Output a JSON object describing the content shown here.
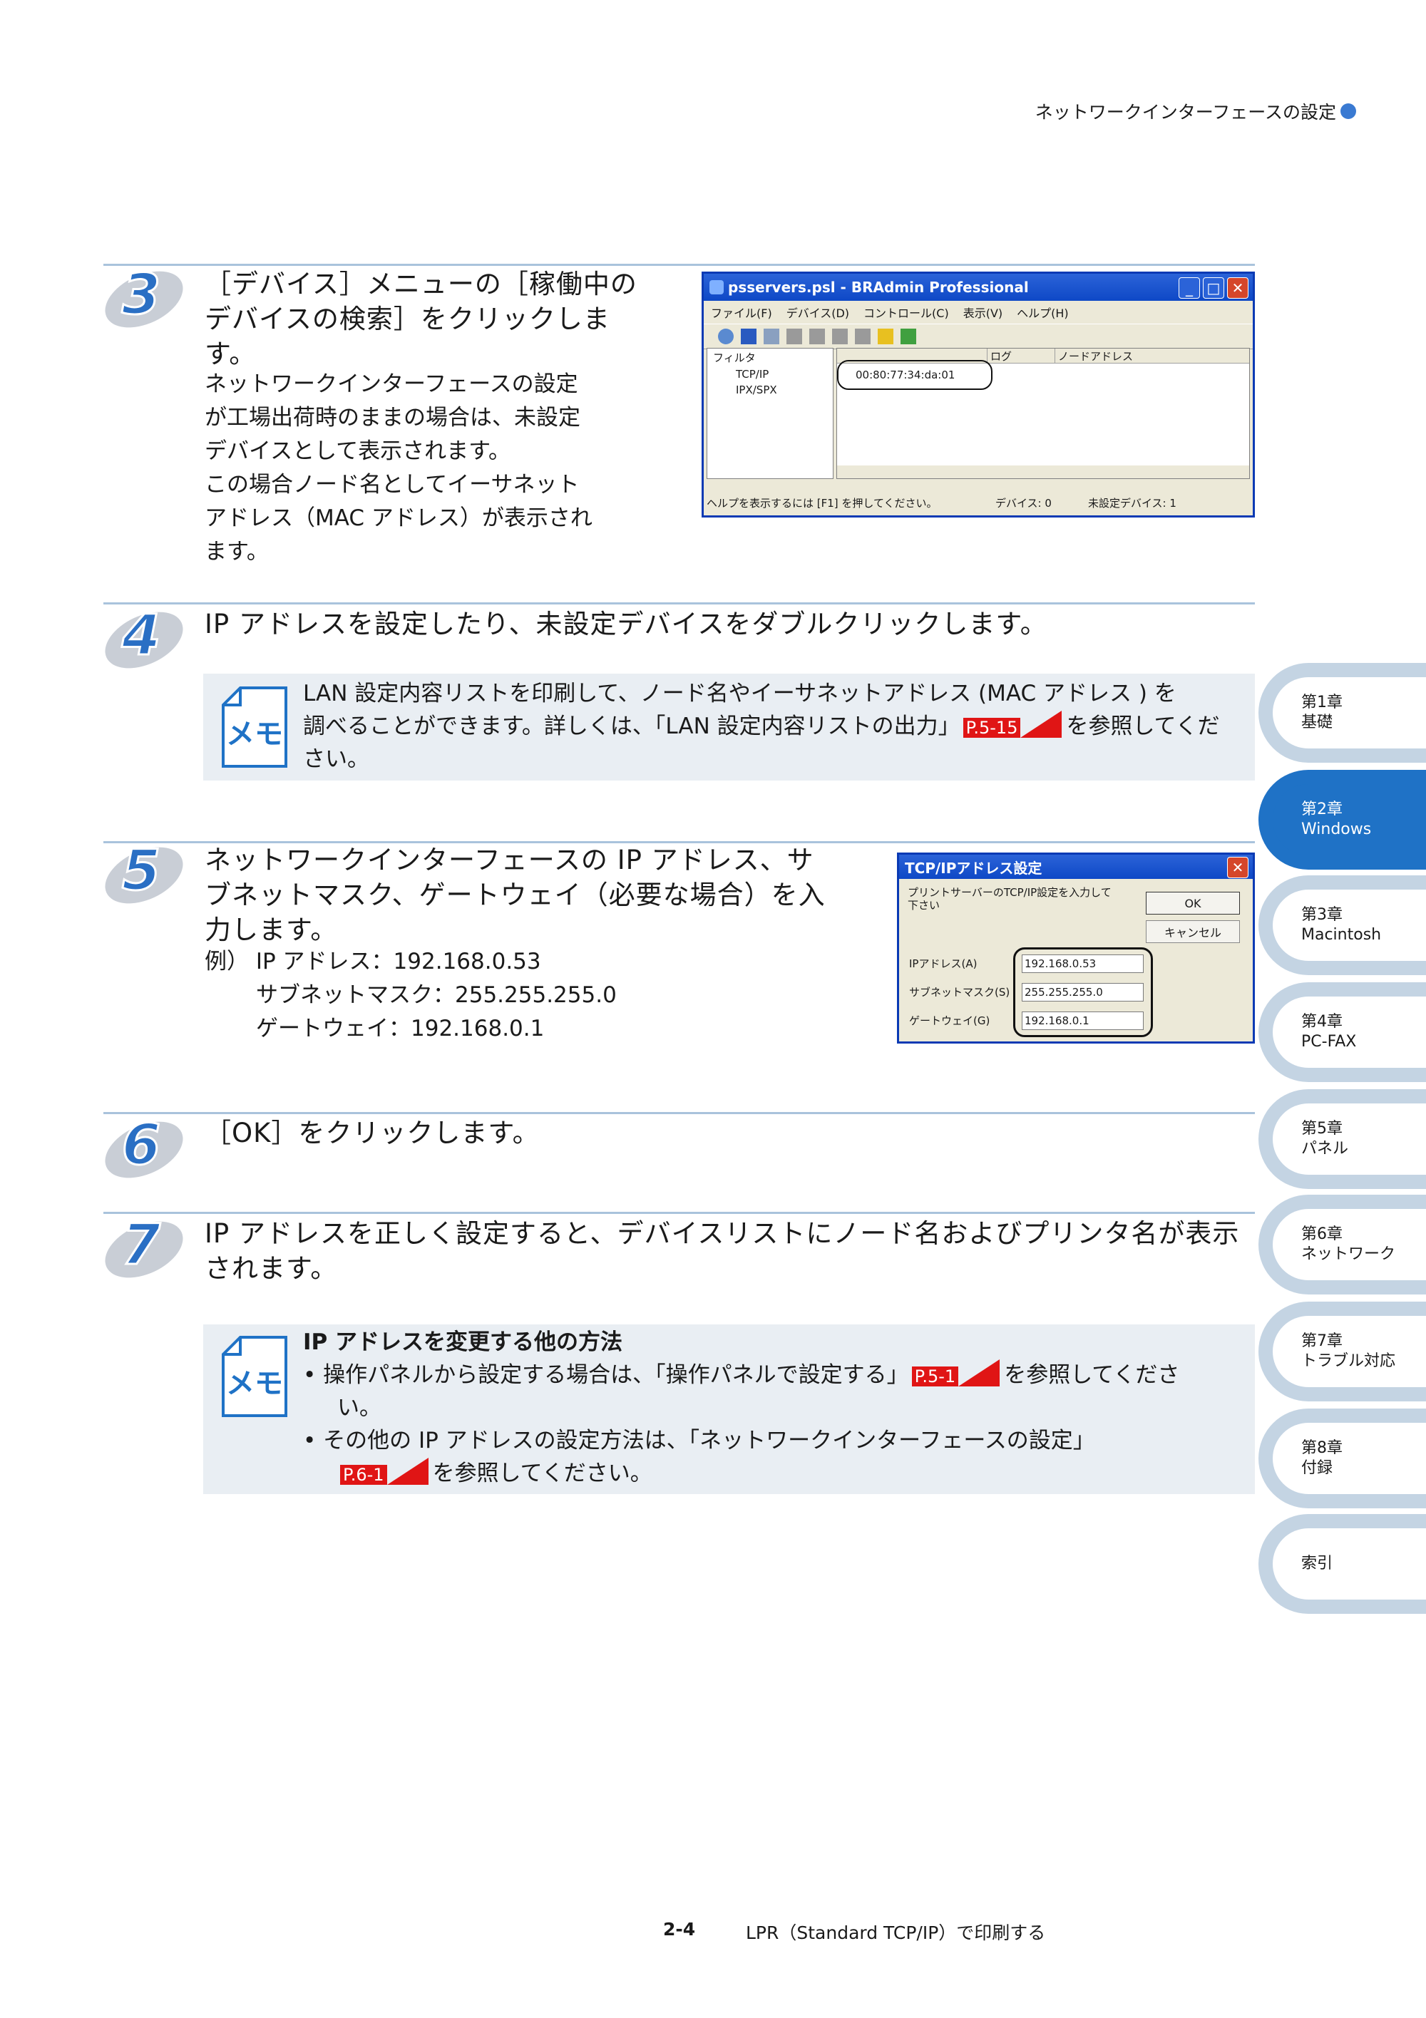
{
  "header": {
    "title": "ネットワークインターフェースの設定"
  },
  "steps": {
    "s3": {
      "number": "3",
      "title_l1": "［デバイス］メニューの［稼働中の",
      "title_l2": "デバイスの検索］をクリックしま",
      "title_l3": "す。",
      "body_l1": "ネットワークインターフェースの設定",
      "body_l2": "が工場出荷時のままの場合は、未設定",
      "body_l3": "デバイスとして表示されます。",
      "body_l4": "この場合ノード名としてイーサネット",
      "body_l5": "アドレス（MAC アドレス）が表示され",
      "body_l6": "ます。"
    },
    "s4": {
      "number": "4",
      "title": "IP アドレスを設定したり、未設定デバイスをダブルクリックします。"
    },
    "s5": {
      "number": "5",
      "title_l1": "ネットワークインターフェースの IP アドレス、サ",
      "title_l2": "ブネットマスク、ゲートウェイ（必要な場合）を入",
      "title_l3": "力します。",
      "ex_l1": "例） IP アドレス：192.168.0.53",
      "ex_l2": "サブネットマスク：255.255.255.0",
      "ex_l3": "ゲートウェイ：192.168.0.1"
    },
    "s6": {
      "number": "6",
      "title": "［OK］をクリックします。"
    },
    "s7": {
      "number": "7",
      "title_l1": "IP アドレスを正しく設定すると、デバイスリストにノード名およびプリンタ名が表示",
      "title_l2": "されます。"
    }
  },
  "memo1": {
    "icon_label": "メモ",
    "l1": "LAN 設定内容リストを印刷して、ノード名やイーサネットアドレス (MAC アドレス ) を",
    "l2a": "調べることができます。詳しくは、「LAN 設定内容リストの出力」",
    "ref": "P.5-15",
    "l2b": "を参照してくだ",
    "l3": "さい。"
  },
  "memo2": {
    "icon_label": "メモ",
    "heading": "IP アドレスを変更する他の方法",
    "b1a": "• 操作パネルから設定する場合は、「操作パネルで設定する」",
    "b1ref": "P.5-1",
    "b1b": "を参照してくださ",
    "b1c": "い。",
    "b2a": "• その他の IP アドレスの設定方法は、「ネットワークインターフェースの設定」",
    "b2ref": "P.6-1",
    "b2b": "を参照してください。"
  },
  "bradmin": {
    "title": "psservers.psl - BRAdmin Professional",
    "menu": [
      "ファイル(F)",
      "デバイス(D)",
      "コントロール(C)",
      "表示(V)",
      "ヘルプ(H)"
    ],
    "tree_root": "フィルタ",
    "tree_items": [
      "TCP/IP",
      "IPX/SPX"
    ],
    "col_headers": [
      "",
      "ログ",
      "ノードアドレス"
    ],
    "device": "00:80:77:34:da:01",
    "status_left": "ヘルプを表示するには [F1] を押してください。",
    "status_mid": "デバイス: 0",
    "status_right": "未設定デバイス: 1"
  },
  "tcpip": {
    "title": "TCP/IPアドレス設定",
    "prompt": "プリントサーバーのTCP/IP設定を入力して下さい",
    "ok": "OK",
    "cancel": "キャンセル",
    "ip_label": "IPアドレス(A)",
    "mask_label": "サブネットマスク(S)",
    "gw_label": "ゲートウェイ(G)",
    "ip": "192.168.0.53",
    "mask": "255.255.255.0",
    "gw": "192.168.0.1"
  },
  "tabs": [
    {
      "l1": "第1章",
      "l2": "基礎"
    },
    {
      "l1": "第2章",
      "l2": "Windows"
    },
    {
      "l1": "第3章",
      "l2": "Macintosh"
    },
    {
      "l1": "第4章",
      "l2": "PC-FAX"
    },
    {
      "l1": "第5章",
      "l2": "パネル"
    },
    {
      "l1": "第6章",
      "l2": "ネットワーク"
    },
    {
      "l1": "第7章",
      "l2": "トラブル対応"
    },
    {
      "l1": "第8章",
      "l2": "付録"
    },
    {
      "l1": "索引",
      "l2": ""
    }
  ],
  "footer": {
    "page": "2-4",
    "title": "LPR（Standard TCP/IP）で印刷する"
  },
  "colors": {
    "accent": "#1f72c6",
    "tab": "#c4d4e3",
    "rule": "#a9c3dc",
    "ref": "#e01515",
    "memo_bg": "#e9eef3"
  }
}
